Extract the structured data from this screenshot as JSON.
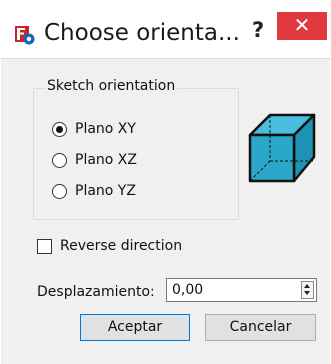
{
  "window": {
    "title": "Choose orienta...",
    "help_label": "?",
    "close_label": "✕"
  },
  "group": {
    "title": "Sketch orientation",
    "options": [
      "Plano XY",
      "Plano XZ",
      "Plano YZ"
    ],
    "selected": "Plano XY"
  },
  "reverse": {
    "label": "Reverse direction",
    "checked": false
  },
  "offset": {
    "label": "Desplazamiento:",
    "value": "0,00"
  },
  "buttons": {
    "ok_label": "Aceptar",
    "cancel_label": "Cancelar"
  },
  "icons": {
    "app": "freecad-sketcher-icon",
    "cube": "cube-orientation-icon"
  },
  "colors": {
    "close_bg": "#e0393e",
    "cube_fill": "#2aa7c9",
    "default_button_border": "#0078d7"
  }
}
